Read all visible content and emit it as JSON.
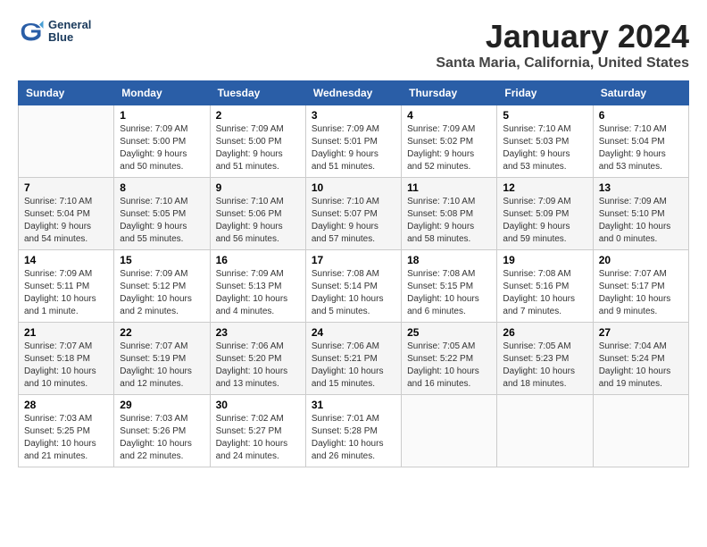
{
  "header": {
    "logo_line1": "General",
    "logo_line2": "Blue",
    "month_title": "January 2024",
    "location": "Santa Maria, California, United States"
  },
  "weekdays": [
    "Sunday",
    "Monday",
    "Tuesday",
    "Wednesday",
    "Thursday",
    "Friday",
    "Saturday"
  ],
  "weeks": [
    [
      {
        "day": "",
        "sunrise": "",
        "sunset": "",
        "daylight": ""
      },
      {
        "day": "1",
        "sunrise": "Sunrise: 7:09 AM",
        "sunset": "Sunset: 5:00 PM",
        "daylight": "Daylight: 9 hours and 50 minutes."
      },
      {
        "day": "2",
        "sunrise": "Sunrise: 7:09 AM",
        "sunset": "Sunset: 5:00 PM",
        "daylight": "Daylight: 9 hours and 51 minutes."
      },
      {
        "day": "3",
        "sunrise": "Sunrise: 7:09 AM",
        "sunset": "Sunset: 5:01 PM",
        "daylight": "Daylight: 9 hours and 51 minutes."
      },
      {
        "day": "4",
        "sunrise": "Sunrise: 7:09 AM",
        "sunset": "Sunset: 5:02 PM",
        "daylight": "Daylight: 9 hours and 52 minutes."
      },
      {
        "day": "5",
        "sunrise": "Sunrise: 7:10 AM",
        "sunset": "Sunset: 5:03 PM",
        "daylight": "Daylight: 9 hours and 53 minutes."
      },
      {
        "day": "6",
        "sunrise": "Sunrise: 7:10 AM",
        "sunset": "Sunset: 5:04 PM",
        "daylight": "Daylight: 9 hours and 53 minutes."
      }
    ],
    [
      {
        "day": "7",
        "sunrise": "Sunrise: 7:10 AM",
        "sunset": "Sunset: 5:04 PM",
        "daylight": "Daylight: 9 hours and 54 minutes."
      },
      {
        "day": "8",
        "sunrise": "Sunrise: 7:10 AM",
        "sunset": "Sunset: 5:05 PM",
        "daylight": "Daylight: 9 hours and 55 minutes."
      },
      {
        "day": "9",
        "sunrise": "Sunrise: 7:10 AM",
        "sunset": "Sunset: 5:06 PM",
        "daylight": "Daylight: 9 hours and 56 minutes."
      },
      {
        "day": "10",
        "sunrise": "Sunrise: 7:10 AM",
        "sunset": "Sunset: 5:07 PM",
        "daylight": "Daylight: 9 hours and 57 minutes."
      },
      {
        "day": "11",
        "sunrise": "Sunrise: 7:10 AM",
        "sunset": "Sunset: 5:08 PM",
        "daylight": "Daylight: 9 hours and 58 minutes."
      },
      {
        "day": "12",
        "sunrise": "Sunrise: 7:09 AM",
        "sunset": "Sunset: 5:09 PM",
        "daylight": "Daylight: 9 hours and 59 minutes."
      },
      {
        "day": "13",
        "sunrise": "Sunrise: 7:09 AM",
        "sunset": "Sunset: 5:10 PM",
        "daylight": "Daylight: 10 hours and 0 minutes."
      }
    ],
    [
      {
        "day": "14",
        "sunrise": "Sunrise: 7:09 AM",
        "sunset": "Sunset: 5:11 PM",
        "daylight": "Daylight: 10 hours and 1 minute."
      },
      {
        "day": "15",
        "sunrise": "Sunrise: 7:09 AM",
        "sunset": "Sunset: 5:12 PM",
        "daylight": "Daylight: 10 hours and 2 minutes."
      },
      {
        "day": "16",
        "sunrise": "Sunrise: 7:09 AM",
        "sunset": "Sunset: 5:13 PM",
        "daylight": "Daylight: 10 hours and 4 minutes."
      },
      {
        "day": "17",
        "sunrise": "Sunrise: 7:08 AM",
        "sunset": "Sunset: 5:14 PM",
        "daylight": "Daylight: 10 hours and 5 minutes."
      },
      {
        "day": "18",
        "sunrise": "Sunrise: 7:08 AM",
        "sunset": "Sunset: 5:15 PM",
        "daylight": "Daylight: 10 hours and 6 minutes."
      },
      {
        "day": "19",
        "sunrise": "Sunrise: 7:08 AM",
        "sunset": "Sunset: 5:16 PM",
        "daylight": "Daylight: 10 hours and 7 minutes."
      },
      {
        "day": "20",
        "sunrise": "Sunrise: 7:07 AM",
        "sunset": "Sunset: 5:17 PM",
        "daylight": "Daylight: 10 hours and 9 minutes."
      }
    ],
    [
      {
        "day": "21",
        "sunrise": "Sunrise: 7:07 AM",
        "sunset": "Sunset: 5:18 PM",
        "daylight": "Daylight: 10 hours and 10 minutes."
      },
      {
        "day": "22",
        "sunrise": "Sunrise: 7:07 AM",
        "sunset": "Sunset: 5:19 PM",
        "daylight": "Daylight: 10 hours and 12 minutes."
      },
      {
        "day": "23",
        "sunrise": "Sunrise: 7:06 AM",
        "sunset": "Sunset: 5:20 PM",
        "daylight": "Daylight: 10 hours and 13 minutes."
      },
      {
        "day": "24",
        "sunrise": "Sunrise: 7:06 AM",
        "sunset": "Sunset: 5:21 PM",
        "daylight": "Daylight: 10 hours and 15 minutes."
      },
      {
        "day": "25",
        "sunrise": "Sunrise: 7:05 AM",
        "sunset": "Sunset: 5:22 PM",
        "daylight": "Daylight: 10 hours and 16 minutes."
      },
      {
        "day": "26",
        "sunrise": "Sunrise: 7:05 AM",
        "sunset": "Sunset: 5:23 PM",
        "daylight": "Daylight: 10 hours and 18 minutes."
      },
      {
        "day": "27",
        "sunrise": "Sunrise: 7:04 AM",
        "sunset": "Sunset: 5:24 PM",
        "daylight": "Daylight: 10 hours and 19 minutes."
      }
    ],
    [
      {
        "day": "28",
        "sunrise": "Sunrise: 7:03 AM",
        "sunset": "Sunset: 5:25 PM",
        "daylight": "Daylight: 10 hours and 21 minutes."
      },
      {
        "day": "29",
        "sunrise": "Sunrise: 7:03 AM",
        "sunset": "Sunset: 5:26 PM",
        "daylight": "Daylight: 10 hours and 22 minutes."
      },
      {
        "day": "30",
        "sunrise": "Sunrise: 7:02 AM",
        "sunset": "Sunset: 5:27 PM",
        "daylight": "Daylight: 10 hours and 24 minutes."
      },
      {
        "day": "31",
        "sunrise": "Sunrise: 7:01 AM",
        "sunset": "Sunset: 5:28 PM",
        "daylight": "Daylight: 10 hours and 26 minutes."
      },
      {
        "day": "",
        "sunrise": "",
        "sunset": "",
        "daylight": ""
      },
      {
        "day": "",
        "sunrise": "",
        "sunset": "",
        "daylight": ""
      },
      {
        "day": "",
        "sunrise": "",
        "sunset": "",
        "daylight": ""
      }
    ]
  ]
}
